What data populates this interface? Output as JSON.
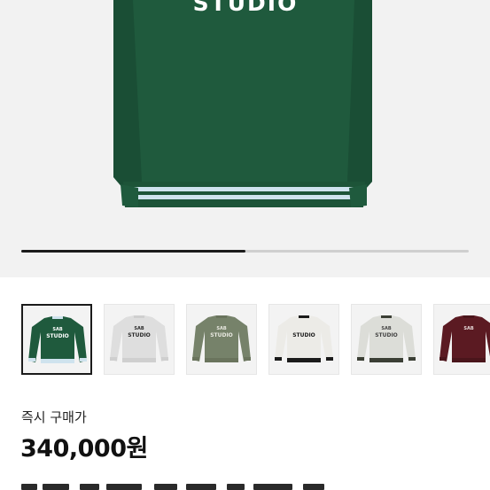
{
  "hero": {
    "image": "green-sweatshirt-back-view",
    "print_text": "STUDIO",
    "colors": {
      "background": "#f2f2f2",
      "body": "#1f5a3d",
      "stripe": "#cfe3ee",
      "print": "#ffffff"
    }
  },
  "gallery": {
    "progress": 0.5,
    "thumbnails": [
      {
        "variant": "green",
        "body": "#1f5a3d",
        "trim": "#cfe3ee",
        "print": "#ffffff",
        "logo": "SAB",
        "line1": "STUDIO",
        "line2": "",
        "selected": true
      },
      {
        "variant": "light-gray",
        "body": "#dedede",
        "trim": "#cfcfcf",
        "print": "#2a2a2a",
        "logo": "SAB",
        "line1": "STUDIO",
        "line2": "",
        "selected": false
      },
      {
        "variant": "khaki",
        "body": "#76826a",
        "trim": "#6a745d",
        "print": "#e8e8e0",
        "logo": "SAB",
        "line1": "STUDIO",
        "line2": "",
        "selected": false
      },
      {
        "variant": "ivory-black-trim",
        "body": "#ecebe7",
        "trim": "#1b1b1b",
        "print": "#1b1b1b",
        "logo": "",
        "line1": "STUDIO",
        "line2": "",
        "selected": false
      },
      {
        "variant": "gray-dark-trim",
        "body": "#dcddd8",
        "trim": "#3b3f35",
        "print": "#444444",
        "logo": "SAB",
        "line1": "STUDIO",
        "line2": "",
        "selected": false
      },
      {
        "variant": "burgundy",
        "body": "#5b1a22",
        "trim": "#4a151b",
        "print": "#e6d8d8",
        "logo": "SAB",
        "line1": "",
        "line2": "",
        "selected": false
      }
    ]
  },
  "purchase": {
    "label": "즉시 구매가",
    "price": "340,000원"
  }
}
